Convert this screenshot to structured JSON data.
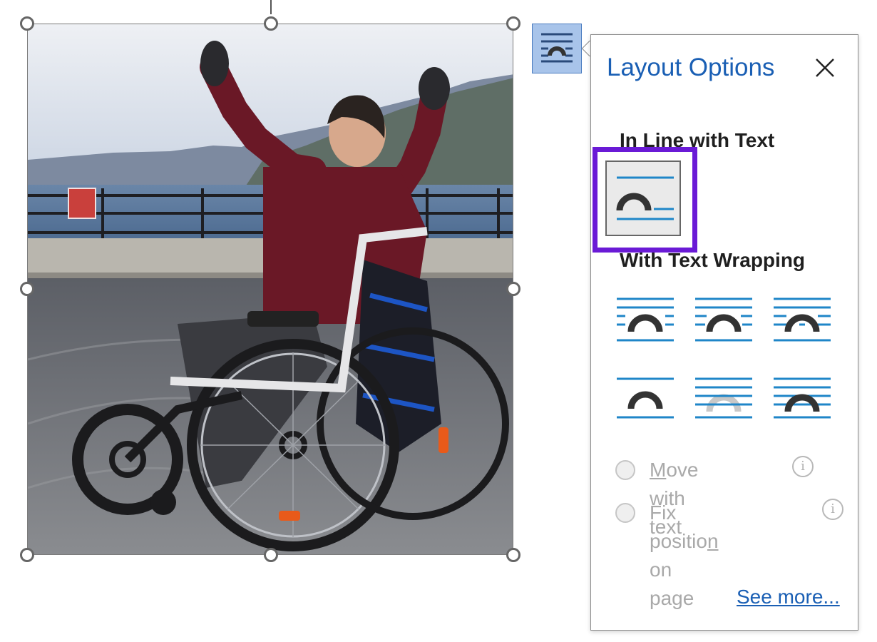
{
  "image": {
    "description_label": "Selected picture"
  },
  "layout_button": {
    "icon": "layout-options-icon"
  },
  "panel": {
    "title": "Layout Options",
    "close_icon": "close-icon",
    "inline_heading": "In Line with Text",
    "wrapping_heading": "With Text Wrapping",
    "move_with_text_pre": "",
    "move_with_text_mn": "M",
    "move_with_text_post": "ove with text",
    "fix_position_pre": "Fix positio",
    "fix_position_mn": "n",
    "fix_position_post": " on",
    "fix_position_line2": "page",
    "info_glyph": "i",
    "see_more": "See more...",
    "colors": {
      "accent": "#1a5fb4",
      "highlight": "#6a1ad6",
      "wrap_lines": "#1f86c8"
    }
  }
}
